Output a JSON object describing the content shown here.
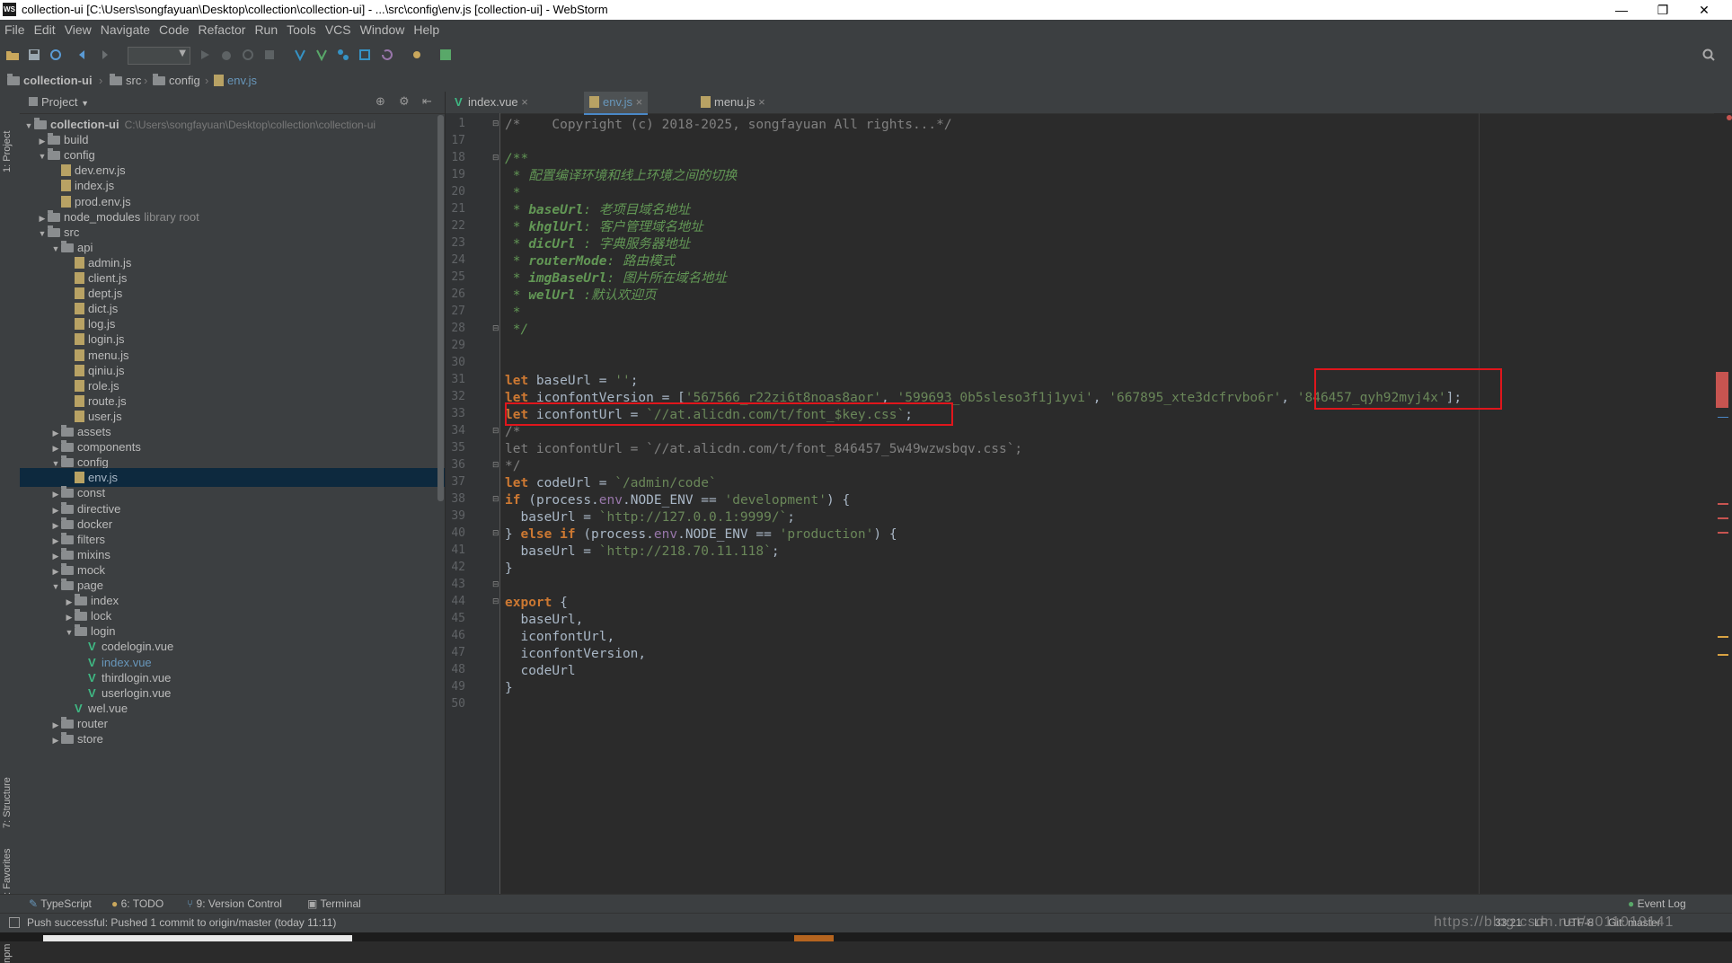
{
  "window": {
    "title": "collection-ui [C:\\Users\\songfayuan\\Desktop\\collection\\collection-ui] - ...\\src\\config\\env.js [collection-ui] - WebStorm",
    "app_badge": "WS",
    "minimize": "—",
    "maximize": "❐",
    "close": "✕"
  },
  "menu": [
    "File",
    "Edit",
    "View",
    "Navigate",
    "Code",
    "Refactor",
    "Run",
    "Tools",
    "VCS",
    "Window",
    "Help"
  ],
  "breadcrumb": [
    "collection-ui",
    "src",
    "config",
    "env.js"
  ],
  "project_panel": {
    "title": "Project",
    "tree": [
      {
        "label": "collection-ui",
        "depth": 0,
        "kind": "root",
        "open": true,
        "hint": "C:\\Users\\songfayuan\\Desktop\\collection\\collection-ui"
      },
      {
        "label": "build",
        "depth": 1,
        "kind": "folder",
        "open": false
      },
      {
        "label": "config",
        "depth": 1,
        "kind": "folder",
        "open": true
      },
      {
        "label": "dev.env.js",
        "depth": 2,
        "kind": "js"
      },
      {
        "label": "index.js",
        "depth": 2,
        "kind": "js"
      },
      {
        "label": "prod.env.js",
        "depth": 2,
        "kind": "js"
      },
      {
        "label": "node_modules",
        "depth": 1,
        "kind": "folder",
        "open": false,
        "hint": "library root"
      },
      {
        "label": "src",
        "depth": 1,
        "kind": "folder",
        "open": true
      },
      {
        "label": "api",
        "depth": 2,
        "kind": "folder",
        "open": true
      },
      {
        "label": "admin.js",
        "depth": 3,
        "kind": "js"
      },
      {
        "label": "client.js",
        "depth": 3,
        "kind": "js"
      },
      {
        "label": "dept.js",
        "depth": 3,
        "kind": "js"
      },
      {
        "label": "dict.js",
        "depth": 3,
        "kind": "js"
      },
      {
        "label": "log.js",
        "depth": 3,
        "kind": "js"
      },
      {
        "label": "login.js",
        "depth": 3,
        "kind": "js"
      },
      {
        "label": "menu.js",
        "depth": 3,
        "kind": "js"
      },
      {
        "label": "qiniu.js",
        "depth": 3,
        "kind": "js"
      },
      {
        "label": "role.js",
        "depth": 3,
        "kind": "js"
      },
      {
        "label": "route.js",
        "depth": 3,
        "kind": "js"
      },
      {
        "label": "user.js",
        "depth": 3,
        "kind": "js"
      },
      {
        "label": "assets",
        "depth": 2,
        "kind": "folder",
        "open": false
      },
      {
        "label": "components",
        "depth": 2,
        "kind": "folder",
        "open": false
      },
      {
        "label": "config",
        "depth": 2,
        "kind": "folder",
        "open": true
      },
      {
        "label": "env.js",
        "depth": 3,
        "kind": "js",
        "selected": true
      },
      {
        "label": "const",
        "depth": 2,
        "kind": "folder",
        "open": false
      },
      {
        "label": "directive",
        "depth": 2,
        "kind": "folder",
        "open": false
      },
      {
        "label": "docker",
        "depth": 2,
        "kind": "folder",
        "open": false
      },
      {
        "label": "filters",
        "depth": 2,
        "kind": "folder",
        "open": false
      },
      {
        "label": "mixins",
        "depth": 2,
        "kind": "folder",
        "open": false
      },
      {
        "label": "mock",
        "depth": 2,
        "kind": "folder",
        "open": false
      },
      {
        "label": "page",
        "depth": 2,
        "kind": "folder",
        "open": true
      },
      {
        "label": "index",
        "depth": 3,
        "kind": "folder",
        "open": false
      },
      {
        "label": "lock",
        "depth": 3,
        "kind": "folder",
        "open": false
      },
      {
        "label": "login",
        "depth": 3,
        "kind": "folder",
        "open": true
      },
      {
        "label": "codelogin.vue",
        "depth": 4,
        "kind": "vue"
      },
      {
        "label": "index.vue",
        "depth": 4,
        "kind": "vue",
        "modified": true
      },
      {
        "label": "thirdlogin.vue",
        "depth": 4,
        "kind": "vue"
      },
      {
        "label": "userlogin.vue",
        "depth": 4,
        "kind": "vue"
      },
      {
        "label": "wel.vue",
        "depth": 3,
        "kind": "vue"
      },
      {
        "label": "router",
        "depth": 2,
        "kind": "folder",
        "open": false
      },
      {
        "label": "store",
        "depth": 2,
        "kind": "folder",
        "open": false
      }
    ]
  },
  "side_tabs": {
    "project": "1: Project",
    "structure": "7: Structure",
    "favorites": "2: Favorites",
    "npm": "npm"
  },
  "editor_tabs": [
    {
      "label": "index.vue",
      "icon": "vue",
      "active": false
    },
    {
      "label": "env.js",
      "icon": "js",
      "active": true
    },
    {
      "label": "menu.js",
      "icon": "js",
      "active": false
    }
  ],
  "code": {
    "line_numbers": [
      "1",
      "17",
      "18",
      "19",
      "20",
      "21",
      "22",
      "23",
      "24",
      "25",
      "26",
      "27",
      "28",
      "29",
      "30",
      "31",
      "32",
      "33",
      "34",
      "35",
      "36",
      "37",
      "38",
      "39",
      "40",
      "41",
      "42",
      "43",
      "44",
      "45",
      "46",
      "47",
      "48",
      "49",
      "50"
    ],
    "lines": [
      [
        {
          "c": "cmt",
          "t": "/*    Copyright (c) 2018-2025, songfayuan All rights...*/"
        }
      ],
      [],
      [
        {
          "c": "doc",
          "t": "/**"
        }
      ],
      [
        {
          "c": "doc",
          "t": " * 配置编译环境和线上环境之间的切换"
        }
      ],
      [
        {
          "c": "doc",
          "t": " *"
        }
      ],
      [
        {
          "c": "doc",
          "t": " * "
        },
        {
          "c": "doctag",
          "t": "baseUrl"
        },
        {
          "c": "doc",
          "t": ": 老项目域名地址"
        }
      ],
      [
        {
          "c": "doc",
          "t": " * "
        },
        {
          "c": "doctag",
          "t": "khglUrl"
        },
        {
          "c": "doc",
          "t": ": 客户管理域名地址"
        }
      ],
      [
        {
          "c": "doc",
          "t": " * "
        },
        {
          "c": "doctag",
          "t": "dicUrl"
        },
        {
          "c": "doc",
          "t": " : 字典服务器地址"
        }
      ],
      [
        {
          "c": "doc",
          "t": " * "
        },
        {
          "c": "doctag",
          "t": "routerMode"
        },
        {
          "c": "doc",
          "t": ": 路由模式"
        }
      ],
      [
        {
          "c": "doc",
          "t": " * "
        },
        {
          "c": "doctag",
          "t": "imgBaseUrl"
        },
        {
          "c": "doc",
          "t": ": 图片所在域名地址"
        }
      ],
      [
        {
          "c": "doc",
          "t": " * "
        },
        {
          "c": "doctag",
          "t": "welUrl"
        },
        {
          "c": "doc",
          "t": " :默认欢迎页"
        }
      ],
      [
        {
          "c": "doc",
          "t": " *"
        }
      ],
      [
        {
          "c": "doc",
          "t": " */"
        }
      ],
      [],
      [],
      [
        {
          "c": "kw",
          "t": "let "
        },
        {
          "c": "var",
          "t": "baseUrl = "
        },
        {
          "c": "str",
          "t": "''"
        },
        {
          "c": "var",
          "t": ";"
        }
      ],
      [
        {
          "c": "kw",
          "t": "let "
        },
        {
          "c": "var",
          "t": "iconfontVersion = ["
        },
        {
          "c": "str",
          "t": "'567566_r22zi6t8noas8aor'"
        },
        {
          "c": "var",
          "t": ", "
        },
        {
          "c": "str",
          "t": "'599693_0b5sleso3f1j1yvi'"
        },
        {
          "c": "var",
          "t": ", "
        },
        {
          "c": "str",
          "t": "'667895_xte3dcfrvbo6r'"
        },
        {
          "c": "var",
          "t": ", "
        },
        {
          "c": "str",
          "t": "'846457_qyh92myj4x'"
        },
        {
          "c": "var",
          "t": "];"
        }
      ],
      [
        {
          "c": "kw",
          "t": "let "
        },
        {
          "c": "var",
          "t": "iconfontUrl = "
        },
        {
          "c": "str",
          "t": "`//at.alicdn.com/t/font_$key.css`"
        },
        {
          "c": "var",
          "t": ";"
        }
      ],
      [
        {
          "c": "cmt",
          "t": "/*"
        }
      ],
      [
        {
          "c": "cmt",
          "t": "let iconfontUrl = `//at.alicdn.com/t/font_846457_5w49wzwsbqv.css`;"
        }
      ],
      [
        {
          "c": "cmt",
          "t": "*/"
        }
      ],
      [
        {
          "c": "kw",
          "t": "let "
        },
        {
          "c": "var",
          "t": "codeUrl = "
        },
        {
          "c": "str",
          "t": "`/admin/code`"
        }
      ],
      [
        {
          "c": "kw",
          "t": "if "
        },
        {
          "c": "var",
          "t": "("
        },
        {
          "c": "var",
          "t": "process."
        },
        {
          "c": "prop",
          "t": "env"
        },
        {
          "c": "var",
          "t": ".NODE_ENV == "
        },
        {
          "c": "str",
          "t": "'development'"
        },
        {
          "c": "var",
          "t": ") {"
        }
      ],
      [
        {
          "c": "var",
          "t": "  baseUrl = "
        },
        {
          "c": "str",
          "t": "`http://127.0.0.1:9999/`"
        },
        {
          "c": "var",
          "t": ";"
        }
      ],
      [
        {
          "c": "var",
          "t": "} "
        },
        {
          "c": "kw",
          "t": "else if "
        },
        {
          "c": "var",
          "t": "("
        },
        {
          "c": "var",
          "t": "process."
        },
        {
          "c": "prop",
          "t": "env"
        },
        {
          "c": "var",
          "t": ".NODE_ENV == "
        },
        {
          "c": "str",
          "t": "'production'"
        },
        {
          "c": "var",
          "t": ") {"
        }
      ],
      [
        {
          "c": "var",
          "t": "  baseUrl = "
        },
        {
          "c": "str",
          "t": "`http://218.70.11.118`"
        },
        {
          "c": "var",
          "t": ";"
        }
      ],
      [
        {
          "c": "var",
          "t": "}"
        }
      ],
      [],
      [
        {
          "c": "kw",
          "t": "export "
        },
        {
          "c": "var",
          "t": "{"
        }
      ],
      [
        {
          "c": "var",
          "t": "  baseUrl,"
        }
      ],
      [
        {
          "c": "var",
          "t": "  iconfontUrl,"
        }
      ],
      [
        {
          "c": "var",
          "t": "  iconfontVersion,"
        }
      ],
      [
        {
          "c": "var",
          "t": "  codeUrl"
        }
      ],
      [
        {
          "c": "var",
          "t": "}"
        }
      ],
      []
    ]
  },
  "bottom_tools": [
    "TypeScript",
    "6: TODO",
    "9: Version Control",
    "Terminal",
    "Event Log"
  ],
  "status": {
    "message": "Push successful: Pushed 1 commit to origin/master (today 11:11)",
    "position": "33:21",
    "line_sep": "LF",
    "encoding": "UTF-8",
    "vcs": "Git: master",
    "watermark": "https://blog.csdn.net/u011019141"
  },
  "colors": {
    "keyword": "#cc7832",
    "string": "#6a8759",
    "comment": "#808080",
    "doc": "#629755",
    "annotation_box": "#e0161c",
    "selection": "#0d293e"
  }
}
